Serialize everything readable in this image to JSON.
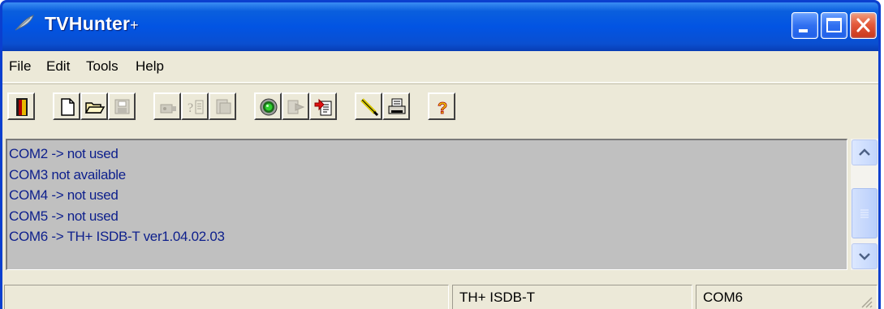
{
  "window": {
    "title": "TVHunter",
    "title_suffix": "+",
    "app_icon": "feather-icon",
    "controls": [
      "minimize-icon",
      "maximize-icon",
      "close-icon"
    ]
  },
  "menu": [
    "File",
    "Edit",
    "Tools",
    "Help"
  ],
  "toolbar": {
    "buttons": [
      {
        "icon": "exit-door-icon",
        "enabled": true
      },
      {
        "icon": "new-document-icon",
        "enabled": true
      },
      {
        "icon": "open-folder-icon",
        "enabled": true
      },
      {
        "icon": "save-icon",
        "enabled": false
      },
      {
        "icon": "device-icon",
        "enabled": false
      },
      {
        "icon": "query-icon",
        "enabled": false
      },
      {
        "icon": "data-icon",
        "enabled": false
      },
      {
        "icon": "connect-green-icon",
        "enabled": true
      },
      {
        "icon": "export-arrow-icon",
        "enabled": false
      },
      {
        "icon": "import-document-icon",
        "enabled": true
      },
      {
        "icon": "pencil-icon",
        "enabled": true
      },
      {
        "icon": "printer-icon",
        "enabled": true
      },
      {
        "icon": "help-question-icon",
        "enabled": true
      }
    ]
  },
  "log": {
    "lines": [
      "COM2 -> not used",
      "COM3 not available",
      "COM4 -> not used",
      "COM5 -> not used",
      "COM6 -> TH+ ISDB-T ver1.04.02.03"
    ]
  },
  "statusbar": {
    "panel1": "",
    "panel2": "TH+ ISDB-T",
    "panel3": "COM6"
  },
  "colors": {
    "titlebar": "#0254e3",
    "log_bg": "#c0c0c0",
    "log_text": "#0d1f8c",
    "face": "#ece9d8"
  }
}
